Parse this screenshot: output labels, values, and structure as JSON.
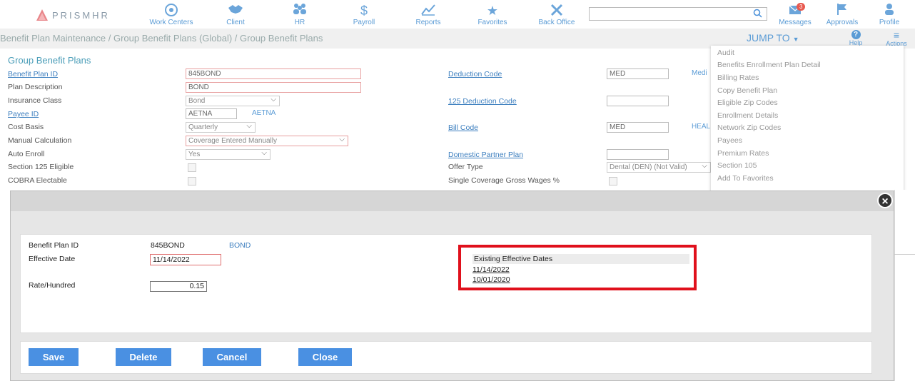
{
  "app": {
    "logo_text": "PRISMHR"
  },
  "nav": [
    {
      "label": "Work Centers",
      "icon": "work-centers-icon"
    },
    {
      "label": "Client",
      "icon": "handshake-icon"
    },
    {
      "label": "HR",
      "icon": "people-icon"
    },
    {
      "label": "Payroll",
      "icon": "dollar-icon"
    },
    {
      "label": "Reports",
      "icon": "chart-icon"
    },
    {
      "label": "Favorites",
      "icon": "star-icon"
    },
    {
      "label": "Back Office",
      "icon": "tools-icon"
    }
  ],
  "search": {
    "placeholder": ""
  },
  "right_nav": {
    "messages": "Messages",
    "messages_count": "3",
    "approvals": "Approvals",
    "profile": "Profile"
  },
  "breadcrumb": "Benefit Plan Maintenance / Group Benefit Plans (Global) / Group Benefit Plans",
  "jump_to": "JUMP TO",
  "help": "Help",
  "actions": "Actions",
  "form": {
    "title": "Group Benefit Plans",
    "benefit_plan_id_label": "Benefit Plan ID",
    "benefit_plan_id": "845BOND",
    "plan_description_label": "Plan Description",
    "plan_description": "BOND",
    "insurance_class_label": "Insurance Class",
    "insurance_class": "Bond",
    "payee_id_label": "Payee ID",
    "payee_id": "AETNA",
    "payee_name": "AETNA",
    "cost_basis_label": "Cost Basis",
    "cost_basis": "Quarterly",
    "manual_calc_label": "Manual Calculation",
    "manual_calc": "Coverage Entered Manually",
    "auto_enroll_label": "Auto Enroll",
    "auto_enroll": "Yes",
    "sec125_label": "Section 125 Eligible",
    "cobra_label": "COBRA Electable",
    "deduction_code_label": "Deduction Code",
    "deduction_code": "MED",
    "deduction_code_desc": "Medi",
    "ded125_label": "125 Deduction Code",
    "bill_code_label": "Bill Code",
    "bill_code": "MED",
    "bill_code_desc": "HEAL",
    "domestic_label": "Domestic Partner Plan",
    "offer_type_label": "Offer Type",
    "offer_type": "Dental (DEN) (Not Valid)",
    "single_cov_label": "Single Coverage Gross Wages %"
  },
  "jump_menu": [
    "Audit",
    "Benefits Enrollment Plan Detail",
    "Billing Rates",
    "Copy Benefit Plan",
    "Eligible Zip Codes",
    "Enrollment Details",
    "Network Zip Codes",
    "Payees",
    "Premium Rates",
    "Section 105",
    "Add To Favorites"
  ],
  "modal": {
    "benefit_plan_id_label": "Benefit Plan ID",
    "benefit_plan_id": "845BOND",
    "benefit_plan_desc": "BOND",
    "effective_date_label": "Effective Date",
    "effective_date": "11/14/2022",
    "rate_label": "Rate/Hundred",
    "rate": "0.15",
    "existing_dates_header": "Existing Effective Dates",
    "existing_dates": [
      "11/14/2022",
      "10/01/2020"
    ],
    "buttons": {
      "save": "Save",
      "delete": "Delete",
      "cancel": "Cancel",
      "close": "Close"
    },
    "highlight_color": "#e0101c"
  }
}
